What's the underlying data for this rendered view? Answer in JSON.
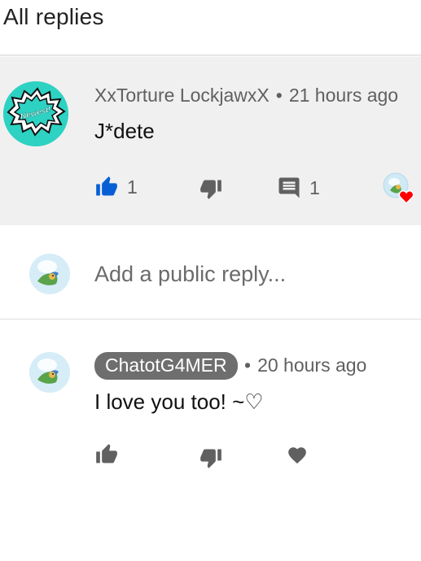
{
  "header": {
    "title": "All replies"
  },
  "parent_comment": {
    "author": "XxTorture LockjawxX",
    "time": "21 hours ago",
    "text": "J*dete",
    "avatar_badge_text": "Newest!",
    "like_count": "1",
    "reply_count": "1",
    "liked_by_creator": true
  },
  "reply_input": {
    "placeholder": "Add a public reply..."
  },
  "reply": {
    "author": "ChatotG4MER",
    "time": "20 hours ago",
    "text": "I love you too! ~♡"
  },
  "colors": {
    "accent": "#065fd4",
    "gray_icon": "#606060",
    "parent_bg": "#f0f0f0",
    "badge_bg": "#2dd2c2",
    "heart": "#ff0000",
    "chip_bg": "#6e6e6e"
  }
}
